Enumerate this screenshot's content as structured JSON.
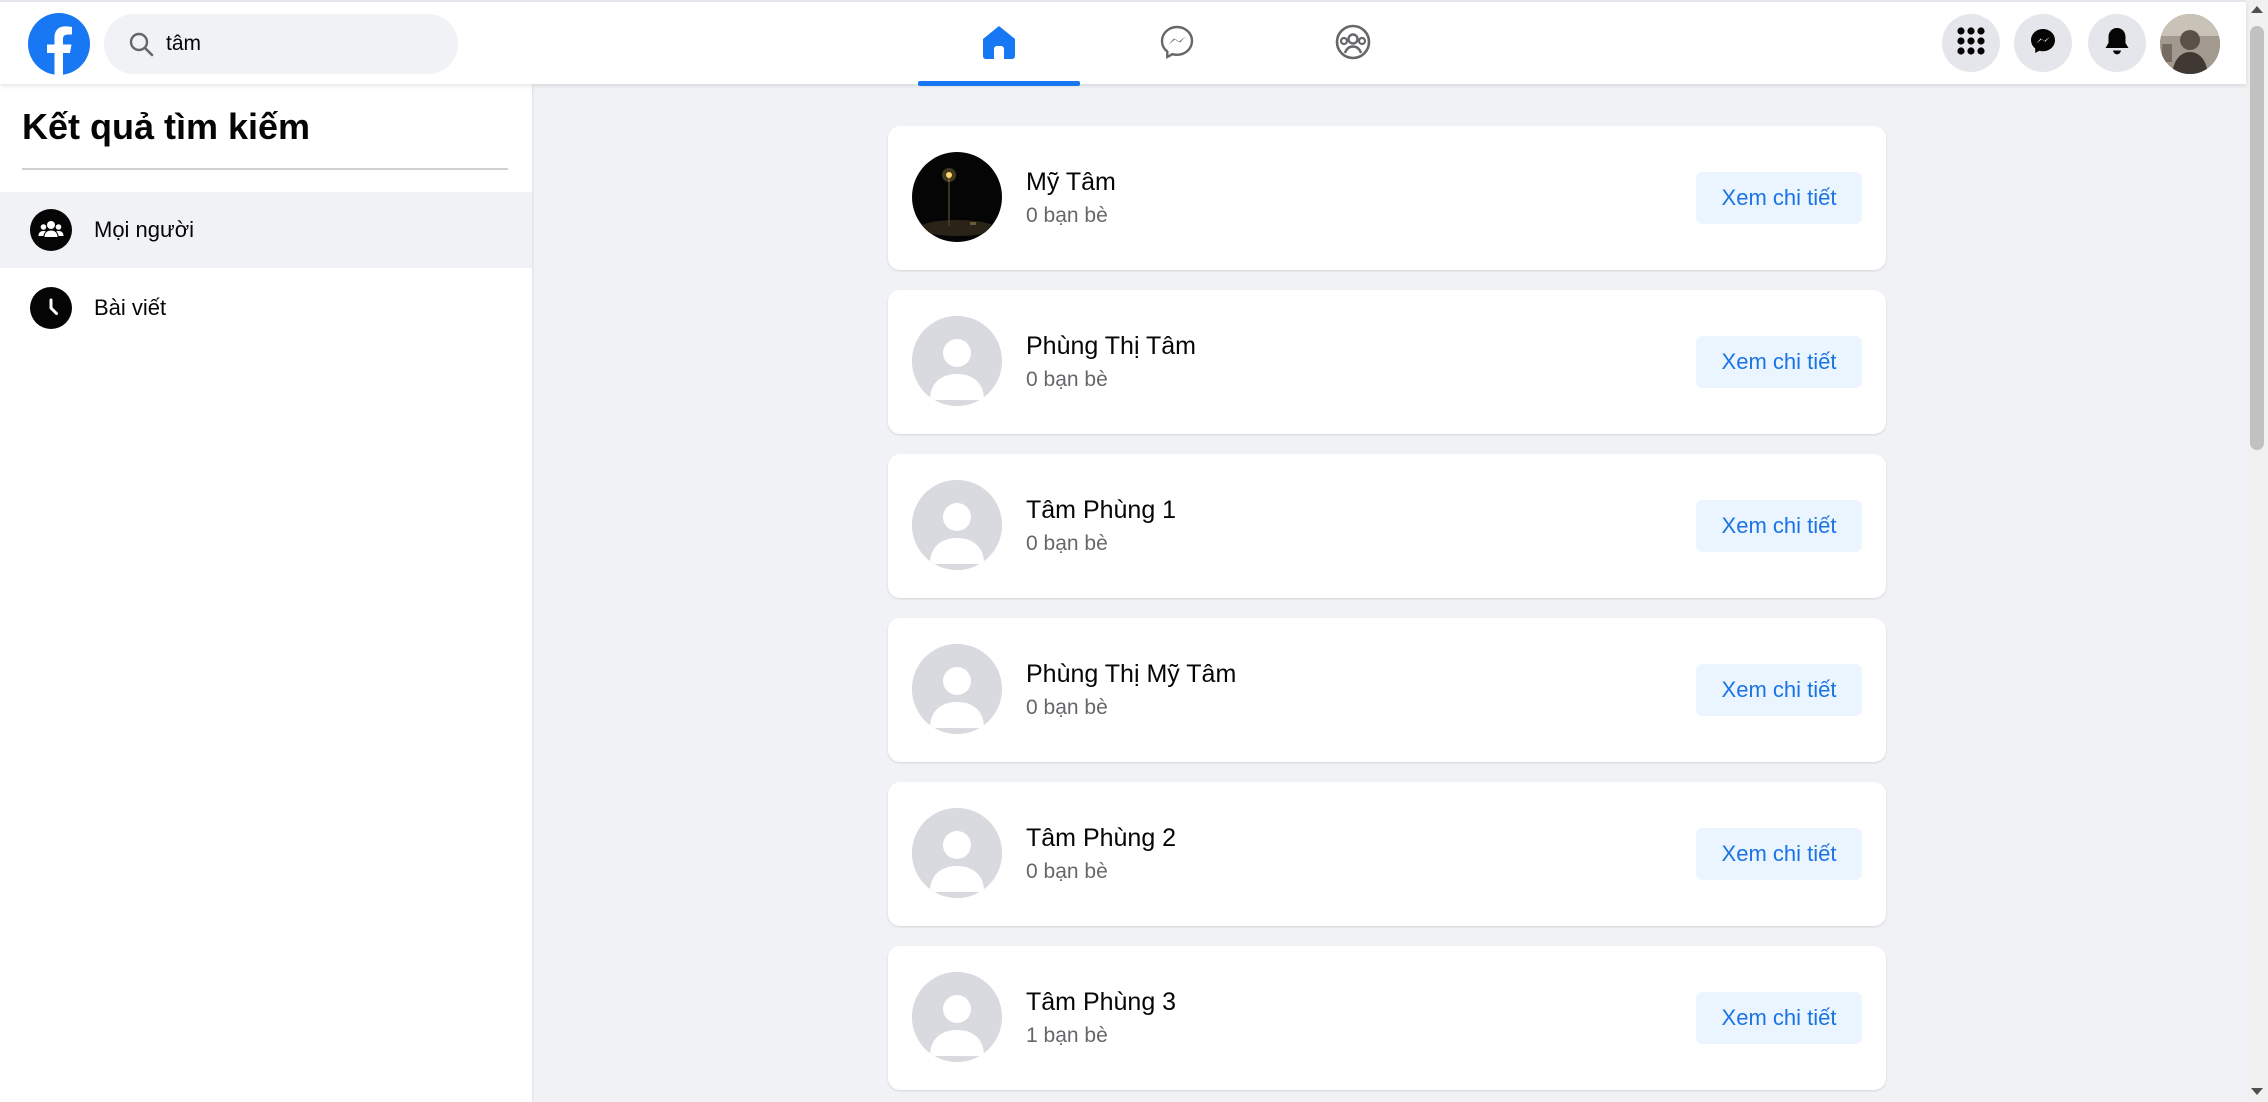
{
  "colors": {
    "brand": "#1877f2",
    "page_background": "#f0f2f5",
    "button_background": "#ebf5ff",
    "button_text": "#1b74e4",
    "secondary_text": "#65676b"
  },
  "header": {
    "logo_icon": "facebook-logo-icon",
    "search": {
      "icon": "search-icon",
      "value": "tâm",
      "placeholder": ""
    },
    "nav_tabs": [
      {
        "id": "home",
        "icon": "home-icon",
        "active": true
      },
      {
        "id": "messenger",
        "icon": "messenger-icon",
        "active": false
      },
      {
        "id": "groups",
        "icon": "groups-icon",
        "active": false
      }
    ],
    "right_buttons": [
      {
        "id": "menu",
        "icon": "grid-menu-icon"
      },
      {
        "id": "chat",
        "icon": "messenger-icon"
      },
      {
        "id": "notifications",
        "icon": "bell-icon"
      },
      {
        "id": "profile",
        "icon": "user-avatar"
      }
    ]
  },
  "sidebar": {
    "title": "Kết quả tìm kiếm",
    "items": [
      {
        "label": "Mọi người",
        "icon": "people-icon",
        "active": true
      },
      {
        "label": "Bài viết",
        "icon": "clock-icon",
        "active": false
      }
    ]
  },
  "results": [
    {
      "name": "Mỹ Tâm",
      "friends": "0 bạn bè",
      "button": "Xem chi tiết",
      "avatar": "photo"
    },
    {
      "name": "Phùng Thị Tâm",
      "friends": "0 bạn bè",
      "button": "Xem chi tiết",
      "avatar": "default"
    },
    {
      "name": "Tâm Phùng 1",
      "friends": "0 bạn bè",
      "button": "Xem chi tiết",
      "avatar": "default"
    },
    {
      "name": "Phùng Thị Mỹ Tâm",
      "friends": "0 bạn bè",
      "button": "Xem chi tiết",
      "avatar": "default"
    },
    {
      "name": "Tâm Phùng 2",
      "friends": "0 bạn bè",
      "button": "Xem chi tiết",
      "avatar": "default"
    },
    {
      "name": "Tâm Phùng 3",
      "friends": "1 bạn bè",
      "button": "Xem chi tiết",
      "avatar": "default"
    }
  ]
}
